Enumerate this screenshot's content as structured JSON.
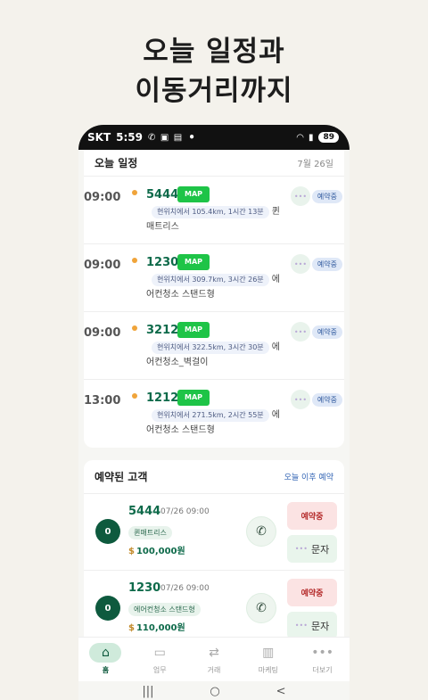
{
  "headline": {
    "line1": "오늘 일정과",
    "line2": "이동거리까지"
  },
  "status_bar": {
    "carrier": "SKT",
    "time": "5:59",
    "dot": "•",
    "battery": "89"
  },
  "today": {
    "title": "오늘 일정",
    "date": "7월 26일",
    "items": [
      {
        "time": "09:00",
        "number": "5444",
        "map": "MAP",
        "distance": "현위치에서 105.4km, 1시간 13분",
        "name_tail": "퀸",
        "name_line2": "매트리스",
        "status": "예약중"
      },
      {
        "time": "09:00",
        "number": "1230",
        "map": "MAP",
        "distance": "현위치에서 309.7km, 3시간 26분",
        "name_tail": "에",
        "name_line2": "어컨청소 스탠드형",
        "status": "예약중"
      },
      {
        "time": "09:00",
        "number": "3212",
        "map": "MAP",
        "distance": "현위치에서 322.5km, 3시간 30분",
        "name_tail": "에",
        "name_line2": "어컨청소_벽걸이",
        "status": "예약중"
      },
      {
        "time": "13:00",
        "number": "1212",
        "map": "MAP",
        "distance": "현위치에서 271.5km, 2시간 55분",
        "name_tail": "에",
        "name_line2": "어컨청소 스탠드형",
        "status": "예약중"
      }
    ]
  },
  "customers": {
    "title": "예약된 고객",
    "link": "오늘 이후 예약",
    "items": [
      {
        "avatar": "0",
        "number": "5444",
        "datetime": "07/26 09:00",
        "tag": "퀸매트리스",
        "price": "100,000원",
        "reserve_label": "예약중",
        "sms_label": "문자"
      },
      {
        "avatar": "0",
        "number": "1230",
        "datetime": "07/26 09:00",
        "tag": "에어컨청소 스탠드형",
        "price": "110,000원",
        "reserve_label": "예약중",
        "sms_label": "문자"
      }
    ]
  },
  "nav": {
    "items": [
      {
        "label": "홈",
        "icon": "home-icon"
      },
      {
        "label": "업무",
        "icon": "clipboard-icon"
      },
      {
        "label": "거래",
        "icon": "swap-icon"
      },
      {
        "label": "마케팅",
        "icon": "bar-chart-icon"
      },
      {
        "label": "더보기",
        "icon": "more-icon"
      }
    ]
  }
}
